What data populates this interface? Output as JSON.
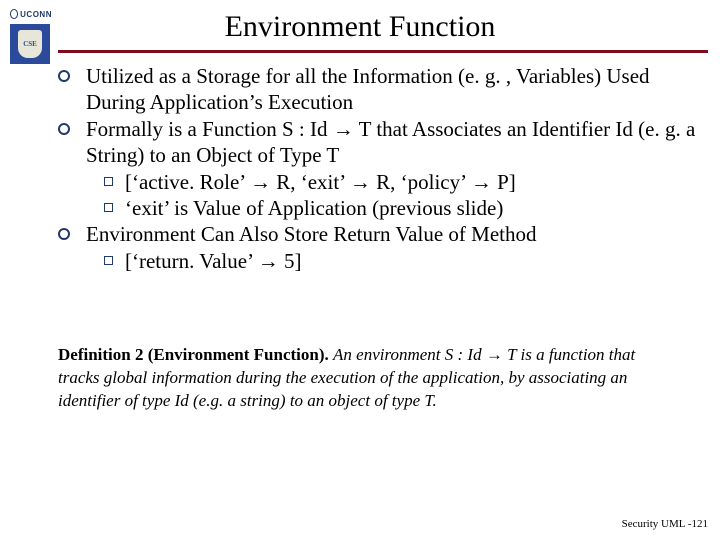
{
  "brand": {
    "uconn": "UCONN",
    "shield": "CSE"
  },
  "title": "Environment Function",
  "bullets": [
    {
      "text": "Utilized as a Storage for all the Information (e. g. , Variables) Used During Application’s Execution",
      "sub": []
    },
    {
      "text": "Formally is a Function S : Id → T that Associates an Identifier Id (e. g. a String) to an Object of Type T",
      "sub": [
        "[‘active. Role’ → R, ‘exit’ → R, ‘policy’ → P]",
        "‘exit’ is Value of Application (previous slide)"
      ]
    },
    {
      "text": "Environment Can Also Store Return Value of Method",
      "sub": [
        "[‘return. Value’ → 5]"
      ]
    }
  ],
  "definition": {
    "heading": "Definition 2  (Environment Function).",
    "body_pre": "An environment ",
    "sig": "S : Id → T",
    "body_post1": " is a function that tracks global information during the execution of the application, by associating an identifier of type Id (e.g. a string) to an object of type T."
  },
  "footer": "Security UML -121"
}
